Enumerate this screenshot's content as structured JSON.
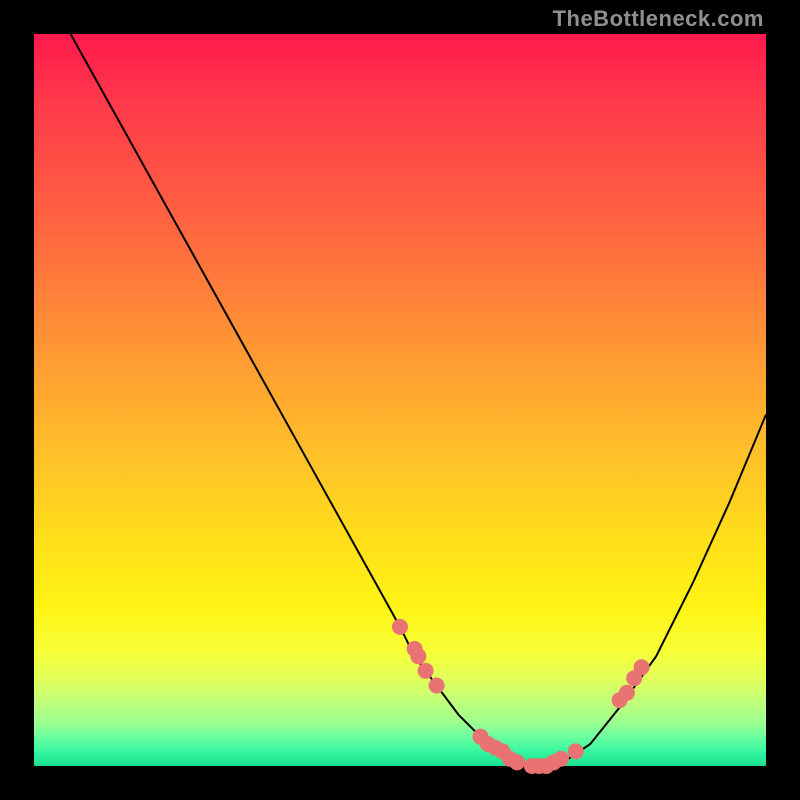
{
  "watermark": "TheBottleneck.com",
  "colors": {
    "dot": "#e97373",
    "curve": "#000000",
    "frame": "#000000"
  },
  "chart_data": {
    "type": "line",
    "title": "",
    "xlabel": "",
    "ylabel": "",
    "xlim": [
      0,
      100
    ],
    "ylim": [
      0,
      100
    ],
    "grid": false,
    "series": [
      {
        "name": "bottleneck-curve",
        "x": [
          5,
          10,
          15,
          20,
          25,
          30,
          35,
          40,
          45,
          50,
          52,
          55,
          58,
          60,
          62,
          65,
          68,
          70,
          73,
          76,
          80,
          85,
          90,
          95,
          100
        ],
        "y": [
          100,
          91,
          82,
          73,
          64,
          55,
          46,
          37,
          28,
          19,
          15,
          11,
          7,
          5,
          3,
          1,
          0,
          0,
          1,
          3,
          8,
          15,
          25,
          36,
          48
        ]
      }
    ],
    "highlight_points": [
      {
        "x": 50,
        "y": 19
      },
      {
        "x": 52,
        "y": 16
      },
      {
        "x": 52.5,
        "y": 15
      },
      {
        "x": 53.5,
        "y": 13
      },
      {
        "x": 55,
        "y": 11
      },
      {
        "x": 61,
        "y": 4
      },
      {
        "x": 62,
        "y": 3
      },
      {
        "x": 63,
        "y": 2.5
      },
      {
        "x": 64,
        "y": 2
      },
      {
        "x": 65,
        "y": 1
      },
      {
        "x": 66,
        "y": 0.5
      },
      {
        "x": 68,
        "y": 0
      },
      {
        "x": 69,
        "y": 0
      },
      {
        "x": 70,
        "y": 0
      },
      {
        "x": 71,
        "y": 0.5
      },
      {
        "x": 72,
        "y": 1
      },
      {
        "x": 74,
        "y": 2
      },
      {
        "x": 80,
        "y": 9
      },
      {
        "x": 81,
        "y": 10
      },
      {
        "x": 82,
        "y": 12
      },
      {
        "x": 83,
        "y": 13.5
      }
    ]
  }
}
